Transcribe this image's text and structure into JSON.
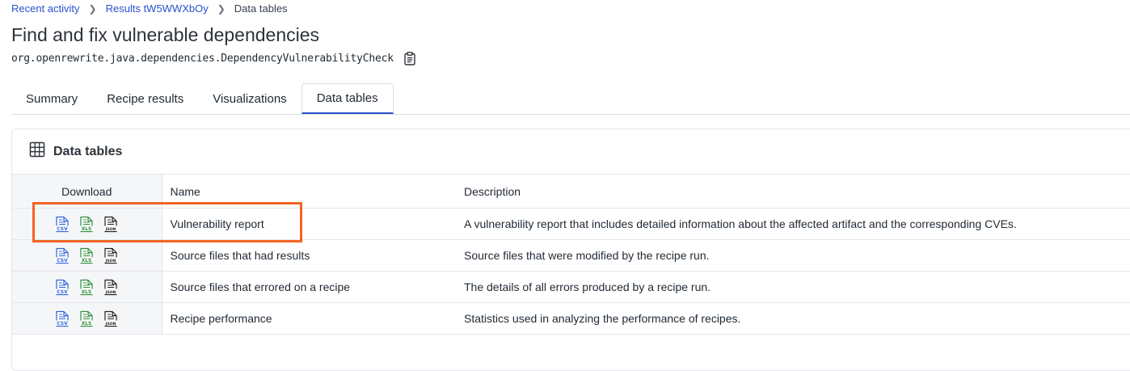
{
  "breadcrumb": {
    "items": [
      {
        "label": "Recent activity"
      },
      {
        "label": "Results tW5WWXbOy"
      }
    ],
    "current": "Data tables"
  },
  "page": {
    "title": "Find and fix vulnerable dependencies",
    "recipe_id": "org.openrewrite.java.dependencies.DependencyVulnerabilityCheck"
  },
  "tabs": [
    {
      "label": "Summary",
      "active": false
    },
    {
      "label": "Recipe results",
      "active": false
    },
    {
      "label": "Visualizations",
      "active": false
    },
    {
      "label": "Data tables",
      "active": true
    }
  ],
  "panel": {
    "title": "Data tables",
    "columns": {
      "download": "Download",
      "name": "Name",
      "description": "Description"
    },
    "rows": [
      {
        "name": "Vulnerability report",
        "description": "A vulnerability report that includes detailed information about the affected artifact and the corresponding CVEs."
      },
      {
        "name": "Source files that had results",
        "description": "Source files that were modified by the recipe run."
      },
      {
        "name": "Source files that errored on a recipe",
        "description": "The details of all errors produced by a recipe run."
      },
      {
        "name": "Recipe performance",
        "description": "Statistics used in analyzing the performance of recipes."
      }
    ]
  },
  "file_icons": [
    {
      "label": "CSV",
      "icon": "csv-file-icon",
      "color": "#2f63d8"
    },
    {
      "label": "XLS",
      "icon": "xls-file-icon",
      "color": "#2e8b3e"
    },
    {
      "label": "JSON",
      "icon": "json-file-icon",
      "color": "#1f1f1f"
    }
  ],
  "colors": {
    "link": "#2952cc",
    "active_tab_underline": "#2952cc",
    "highlight": "#f26522"
  }
}
